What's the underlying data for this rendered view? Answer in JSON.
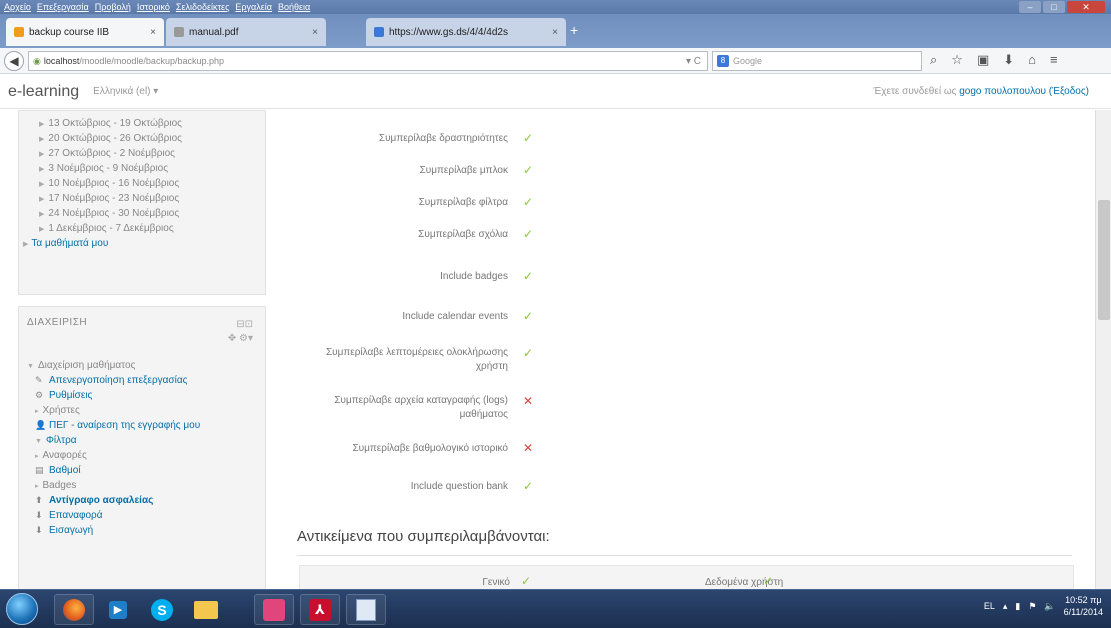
{
  "browser": {
    "menu": [
      "Αρχείο",
      "Επεξεργασία",
      "Προβολή",
      "Ιστορικό",
      "Σελιδοδείκτες",
      "Εργαλεία",
      "Βοήθεια"
    ],
    "tabs": [
      {
        "title": "backup course ΙΙΒ",
        "active": true
      },
      {
        "title": "manual.pdf",
        "active": false
      },
      {
        "title": "https://www.gs.ds/4/4/4d2s",
        "active": false
      }
    ],
    "url_host": "localhost",
    "url_path": "/moodle/moodle/backup/backup.php",
    "search_placeholder": "Google",
    "toolbar_icons": [
      "search-icon",
      "star-icon",
      "clipboard-icon",
      "download-icon",
      "home-icon",
      "menu-icon"
    ]
  },
  "moodle": {
    "brand": "e-learning",
    "language": "Ελληνικά (el) ▾",
    "login_text": "Έχετε συνδεθεί ως",
    "user_name": "gogo πουλοπουλου",
    "logout": "(Έξοδος)"
  },
  "weeks": [
    "13 Οκτώβριος - 19 Οκτώβριος",
    "20 Οκτώβριος - 26 Οκτώβριος",
    "27 Οκτώβριος - 2 Νοέμβριος",
    "3 Νοέμβριος - 9 Νοέμβριος",
    "10 Νοέμβριος - 16 Νοέμβριος",
    "17 Νοέμβριος - 23 Νοέμβριος",
    "24 Νοέμβριος - 30 Νοέμβριος",
    "1 Δεκέμβριος - 7 Δεκέμβριος"
  ],
  "my_courses": "Τα μαθήματά μου",
  "admin": {
    "title": "ΔΙΑΧΕΙΡΙΣΗ",
    "items": [
      {
        "label": "Διαχείριση μαθήματος",
        "level": 0,
        "style": "normal",
        "icon": "▼"
      },
      {
        "label": "Απενεργοποίηση επεξεργασίας",
        "level": 1,
        "style": "link",
        "icon": "✎"
      },
      {
        "label": "Ρυθμίσεις",
        "level": 1,
        "style": "link",
        "icon": "⚙"
      },
      {
        "label": "Χρήστες",
        "level": 1,
        "style": "normal",
        "icon": "▸"
      },
      {
        "label": "ΠΕΓ - αναίρεση της εγγραφής μου",
        "level": 1,
        "style": "link",
        "icon": "👤"
      },
      {
        "label": "Φίλτρα",
        "level": 1,
        "style": "link",
        "icon": "▼"
      },
      {
        "label": "Αναφορές",
        "level": 1,
        "style": "normal",
        "icon": "▸"
      },
      {
        "label": "Βαθμοί",
        "level": 1,
        "style": "link",
        "icon": "▤"
      },
      {
        "label": "Badges",
        "level": 1,
        "style": "normal",
        "icon": "▸"
      },
      {
        "label": "Αντίγραφο ασφαλείας",
        "level": 1,
        "style": "bold",
        "icon": "⬆"
      },
      {
        "label": "Επαναφορά",
        "level": 1,
        "style": "link",
        "icon": "⬇"
      },
      {
        "label": "Εισαγωγή",
        "level": 1,
        "style": "link",
        "icon": "⬇"
      }
    ]
  },
  "settings": [
    {
      "label": "Συμπερίλαβε δραστηριότητες",
      "included": true
    },
    {
      "label": "Συμπερίλαβε μπλοκ",
      "included": true
    },
    {
      "label": "Συμπερίλαβε φίλτρα",
      "included": true
    },
    {
      "label": "Συμπερίλαβε σχόλια",
      "included": true
    },
    {
      "label": "Include badges",
      "included": true
    },
    {
      "label": "Include calendar events",
      "included": true
    },
    {
      "label": "Συμπερίλαβε λεπτομέρειες ολοκλήρωσης χρήστη",
      "included": true
    },
    {
      "label": "Συμπερίλαβε αρχεία καταγραφής (logs) μαθήματος",
      "included": false
    },
    {
      "label": "Συμπερίλαβε βαθμολογικό ιστορικό",
      "included": false
    },
    {
      "label": "Include question bank",
      "included": true
    }
  ],
  "included_section": {
    "title": "Αντικείμενα που συμπεριλαμβάνονται:",
    "items": [
      {
        "label": "Γενικό",
        "included": true
      },
      {
        "label": "Δεδομένα χρήστη",
        "included": true
      }
    ]
  },
  "taskbar": {
    "apps": [
      "firefox",
      "media-player",
      "skype",
      "file-explorer",
      "puzzle-app",
      "acrobat",
      "notepad"
    ],
    "tray_lang": "EL",
    "time": "10:52 πμ",
    "date": "6/11/2014"
  }
}
